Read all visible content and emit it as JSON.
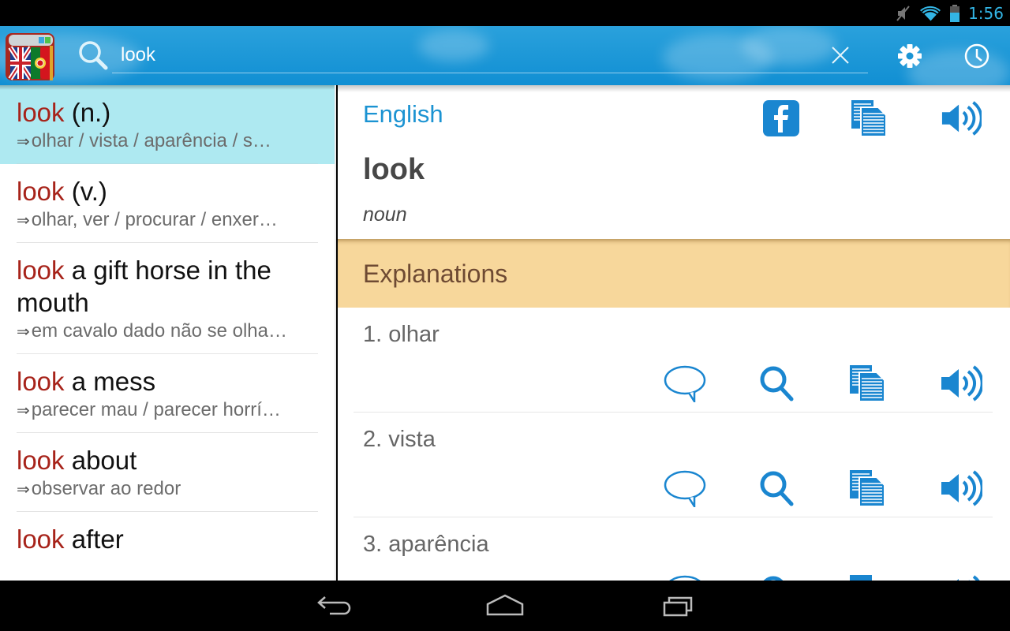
{
  "status_bar": {
    "time": "1:56",
    "icons": [
      "mute-icon",
      "wifi-icon",
      "battery-icon"
    ],
    "accent_color": "#33b5e5"
  },
  "action_bar": {
    "app_logo": "english-portuguese-dictionary-logo",
    "search": {
      "value": "look",
      "placeholder": ""
    },
    "buttons": {
      "clear": "clear-icon",
      "settings": "gear-icon",
      "history": "clock-icon"
    }
  },
  "results": [
    {
      "keyword": "look",
      "rest": "(n.)",
      "translation": "olhar / vista / aparência / s…",
      "selected": true
    },
    {
      "keyword": "look",
      "rest": "(v.)",
      "translation": "olhar, ver / procurar / enxer…",
      "selected": false
    },
    {
      "keyword": "look",
      "rest": "a gift horse in the mouth",
      "translation": "em cavalo dado não se olha…",
      "selected": false
    },
    {
      "keyword": "look",
      "rest": "a mess",
      "translation": "parecer mau / parecer horrí…",
      "selected": false
    },
    {
      "keyword": "look",
      "rest": "about",
      "translation": "observar ao redor",
      "selected": false
    },
    {
      "keyword": "look",
      "rest": "after",
      "translation": "",
      "selected": false
    }
  ],
  "result_arrow": "⇒",
  "detail": {
    "language": "English",
    "word": "look",
    "part_of_speech": "noun",
    "top_actions": [
      "facebook-icon",
      "copy-icon",
      "speaker-icon"
    ],
    "section_title": "Explanations",
    "senses": [
      {
        "label": "1. olhar",
        "actions": [
          "speech-bubble-icon",
          "search-icon",
          "copy-icon",
          "speaker-icon"
        ]
      },
      {
        "label": "2. vista",
        "actions": [
          "speech-bubble-icon",
          "search-icon",
          "copy-icon",
          "speaker-icon"
        ]
      },
      {
        "label": "3. aparência",
        "actions": [
          "speech-bubble-icon",
          "search-icon",
          "copy-icon",
          "speaker-icon"
        ]
      }
    ]
  },
  "nav_bar": {
    "buttons": [
      "back-icon",
      "home-icon",
      "recent-apps-icon"
    ]
  },
  "colors": {
    "keyword": "#a7231a",
    "selected_row": "#aee9f1",
    "language_label": "#1b93d2",
    "icon_blue": "#1a86d0",
    "section_bar": "#f7d79b",
    "section_text": "#6e4a33"
  }
}
